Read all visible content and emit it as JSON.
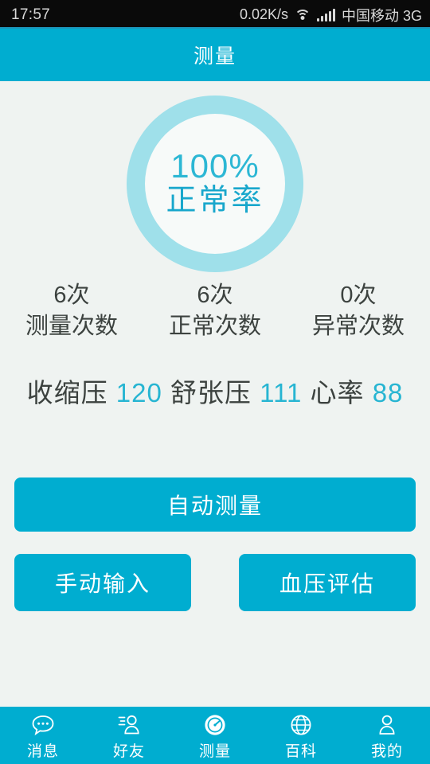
{
  "statusbar": {
    "time": "17:57",
    "network_speed": "0.02K/s",
    "wifi_icon": "wifi-icon",
    "signal_icon": "signal-bars-icon",
    "carrier": "中国移动 3G"
  },
  "header": {
    "title": "测量"
  },
  "gauge": {
    "percent": "100%",
    "label": "正常率",
    "ring_color": "#9FE0EA",
    "text_color": "#2CB7D4",
    "inner_color": "#F7FAF9"
  },
  "stats": [
    {
      "value": "6次",
      "label": "测量次数"
    },
    {
      "value": "6次",
      "label": "正常次数"
    },
    {
      "value": "0次",
      "label": "异常次数"
    }
  ],
  "vitals": {
    "systolic_label": "收缩压",
    "systolic_value": "120",
    "diastolic_label": "舒张压",
    "diastolic_value": "111",
    "heartrate_label": "心率",
    "heartrate_value": "88",
    "value_color": "#27B5D2"
  },
  "buttons": {
    "auto_measure": "自动测量",
    "manual_input": "手动输入",
    "bp_assessment": "血压评估",
    "color": "#00ADD0"
  },
  "navbar": {
    "active": "测量",
    "items": [
      {
        "label": "消息",
        "icon": "chat-bubble-icon"
      },
      {
        "label": "好友",
        "icon": "friends-person-icon"
      },
      {
        "label": "测量",
        "icon": "gauge-meter-icon"
      },
      {
        "label": "百科",
        "icon": "globe-icon"
      },
      {
        "label": "我的",
        "icon": "person-icon"
      }
    ]
  },
  "chart_data": {
    "type": "pie",
    "title": "正常率",
    "categories": [
      "正常次数",
      "异常次数"
    ],
    "values": [
      6,
      0
    ],
    "percent": 100,
    "total": 6
  }
}
